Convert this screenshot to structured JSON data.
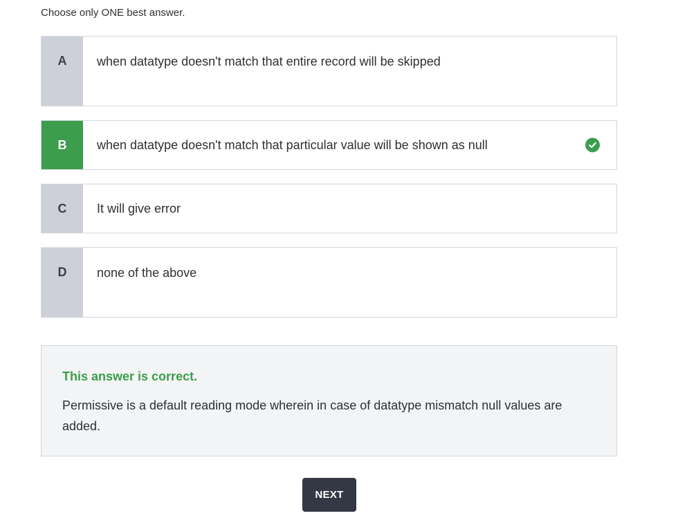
{
  "instruction": "Choose only ONE best answer.",
  "options": [
    {
      "letter": "A",
      "text": "when datatype doesn't match that entire record will be skipped",
      "selected": false
    },
    {
      "letter": "B",
      "text": "when datatype doesn't match that particular value will be shown as null",
      "selected": true
    },
    {
      "letter": "C",
      "text": "It will give error",
      "selected": false
    },
    {
      "letter": "D",
      "text": "none of the above",
      "selected": false
    }
  ],
  "feedback": {
    "status": "This answer is correct.",
    "explanation": "Permissive is a default reading mode wherein in case of datatype mismatch null values are added."
  },
  "next_label": "NEXT",
  "colors": {
    "correct": "#3c9d4d",
    "letter_bg": "#cdd0d8",
    "button_bg": "#343744",
    "feedback_bg": "#f3f4f5"
  },
  "icons": {
    "selected_check": "check-circle-icon"
  }
}
